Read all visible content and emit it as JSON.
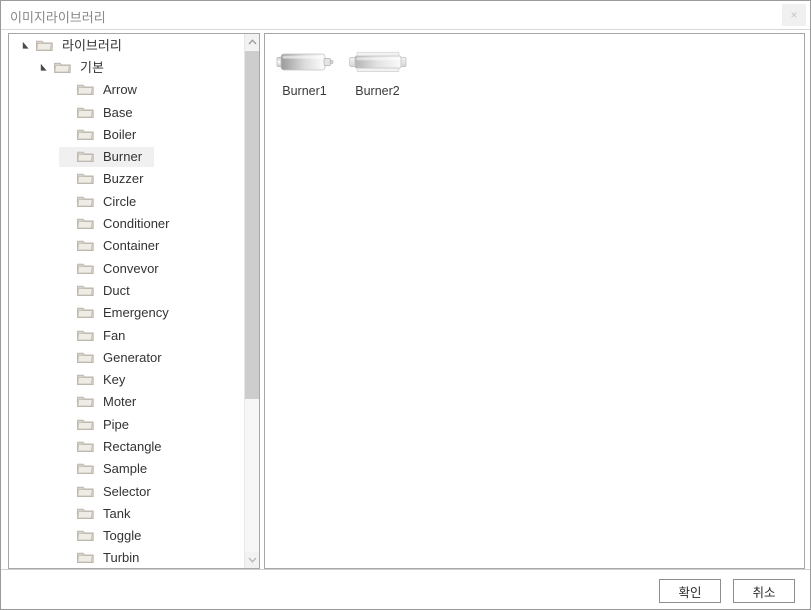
{
  "window": {
    "title": "이미지라이브러리",
    "close_label": "×",
    "close_icon": "close-icon"
  },
  "tree": {
    "items": [
      {
        "label": "라이브러리",
        "depth": 0,
        "expanded": true,
        "selected": false,
        "icon": "folder-icon"
      },
      {
        "label": "기본",
        "depth": 1,
        "expanded": true,
        "selected": false,
        "icon": "folder-icon"
      },
      {
        "label": "Arrow",
        "depth": 2,
        "expanded": false,
        "selected": false,
        "icon": "folder-icon"
      },
      {
        "label": "Base",
        "depth": 2,
        "expanded": false,
        "selected": false,
        "icon": "folder-icon"
      },
      {
        "label": "Boiler",
        "depth": 2,
        "expanded": false,
        "selected": false,
        "icon": "folder-icon"
      },
      {
        "label": "Burner",
        "depth": 2,
        "expanded": false,
        "selected": true,
        "icon": "folder-icon"
      },
      {
        "label": "Buzzer",
        "depth": 2,
        "expanded": false,
        "selected": false,
        "icon": "folder-icon"
      },
      {
        "label": "Circle",
        "depth": 2,
        "expanded": false,
        "selected": false,
        "icon": "folder-icon"
      },
      {
        "label": "Conditioner",
        "depth": 2,
        "expanded": false,
        "selected": false,
        "icon": "folder-icon"
      },
      {
        "label": "Container",
        "depth": 2,
        "expanded": false,
        "selected": false,
        "icon": "folder-icon"
      },
      {
        "label": "Convevor",
        "depth": 2,
        "expanded": false,
        "selected": false,
        "icon": "folder-icon"
      },
      {
        "label": "Duct",
        "depth": 2,
        "expanded": false,
        "selected": false,
        "icon": "folder-icon"
      },
      {
        "label": "Emergency",
        "depth": 2,
        "expanded": false,
        "selected": false,
        "icon": "folder-icon"
      },
      {
        "label": "Fan",
        "depth": 2,
        "expanded": false,
        "selected": false,
        "icon": "folder-icon"
      },
      {
        "label": "Generator",
        "depth": 2,
        "expanded": false,
        "selected": false,
        "icon": "folder-icon"
      },
      {
        "label": "Key",
        "depth": 2,
        "expanded": false,
        "selected": false,
        "icon": "folder-icon"
      },
      {
        "label": "Moter",
        "depth": 2,
        "expanded": false,
        "selected": false,
        "icon": "folder-icon"
      },
      {
        "label": "Pipe",
        "depth": 2,
        "expanded": false,
        "selected": false,
        "icon": "folder-icon"
      },
      {
        "label": "Rectangle",
        "depth": 2,
        "expanded": false,
        "selected": false,
        "icon": "folder-icon"
      },
      {
        "label": "Sample",
        "depth": 2,
        "expanded": false,
        "selected": false,
        "icon": "folder-icon"
      },
      {
        "label": "Selector",
        "depth": 2,
        "expanded": false,
        "selected": false,
        "icon": "folder-icon"
      },
      {
        "label": "Tank",
        "depth": 2,
        "expanded": false,
        "selected": false,
        "icon": "folder-icon"
      },
      {
        "label": "Toggle",
        "depth": 2,
        "expanded": false,
        "selected": false,
        "icon": "folder-icon"
      },
      {
        "label": "Turbin",
        "depth": 2,
        "expanded": false,
        "selected": false,
        "icon": "folder-icon"
      }
    ],
    "scrollbar": {
      "up_icon": "chevron-up-icon",
      "down_icon": "chevron-down-icon",
      "thumb_color": "#cdcdcd"
    }
  },
  "content": {
    "thumbnails": [
      {
        "label": "Burner1",
        "style": "burner-right-nozzle"
      },
      {
        "label": "Burner2",
        "style": "burner-two-caps"
      }
    ]
  },
  "footer": {
    "ok_label": "확인",
    "cancel_label": "취소"
  },
  "colors": {
    "window_border": "#9a9a9a",
    "panel_border": "#a7a7a7",
    "selection": "#f0f0f0",
    "title_text": "#888888",
    "body_text": "#333333"
  }
}
